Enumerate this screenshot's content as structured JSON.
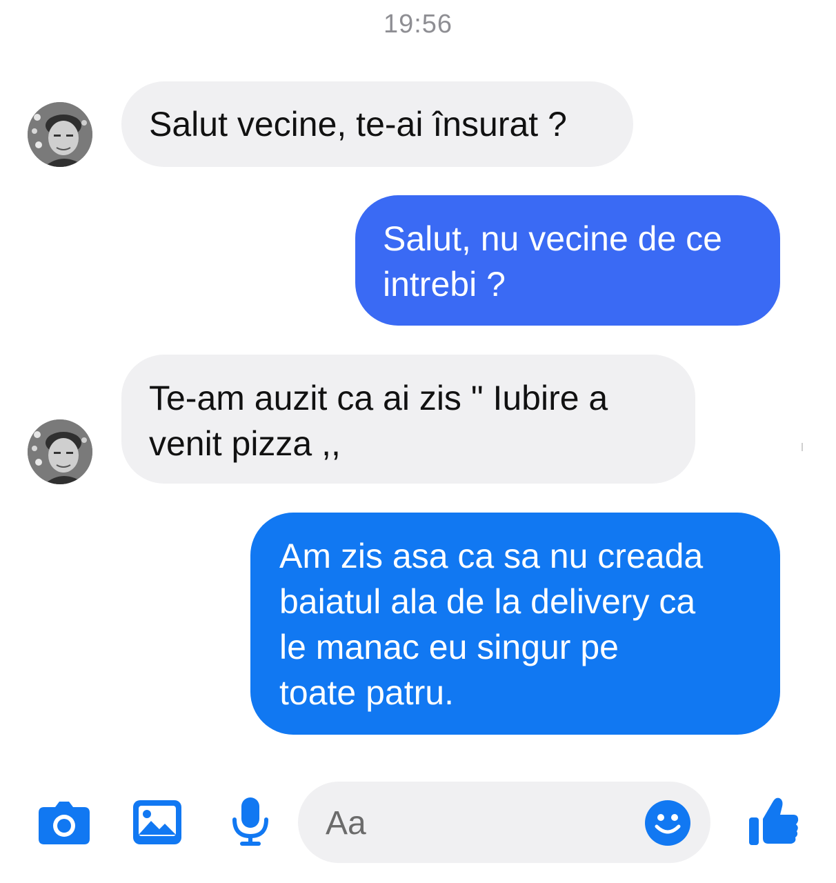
{
  "header": {
    "timestamp": "19:56"
  },
  "conversation": {
    "messages": [
      {
        "direction": "incoming",
        "text": "Salut vecine, te-ai însurat ?"
      },
      {
        "direction": "outgoing",
        "text": "Salut, nu vecine de ce\nintrebi ?"
      },
      {
        "direction": "incoming",
        "text": "Te-am auzit ca ai zis \" Iubire a\nvenit pizza ,,"
      },
      {
        "direction": "outgoing",
        "text": "Am zis asa ca sa nu creada\nbaiatul ala de la delivery ca\nle manac eu singur pe\ntoate patru."
      }
    ]
  },
  "composer": {
    "placeholder": "Aa",
    "icons": [
      "camera-icon",
      "image-icon",
      "microphone-icon",
      "emoji-icon",
      "thumbs-up-icon"
    ]
  },
  "colors": {
    "accent": "#1178f2",
    "outgoing_bubble_1": "#3a6af4",
    "outgoing_bubble_2": "#1178f2",
    "incoming_bubble": "#f0f0f2",
    "timestamp": "#8e8e93"
  }
}
